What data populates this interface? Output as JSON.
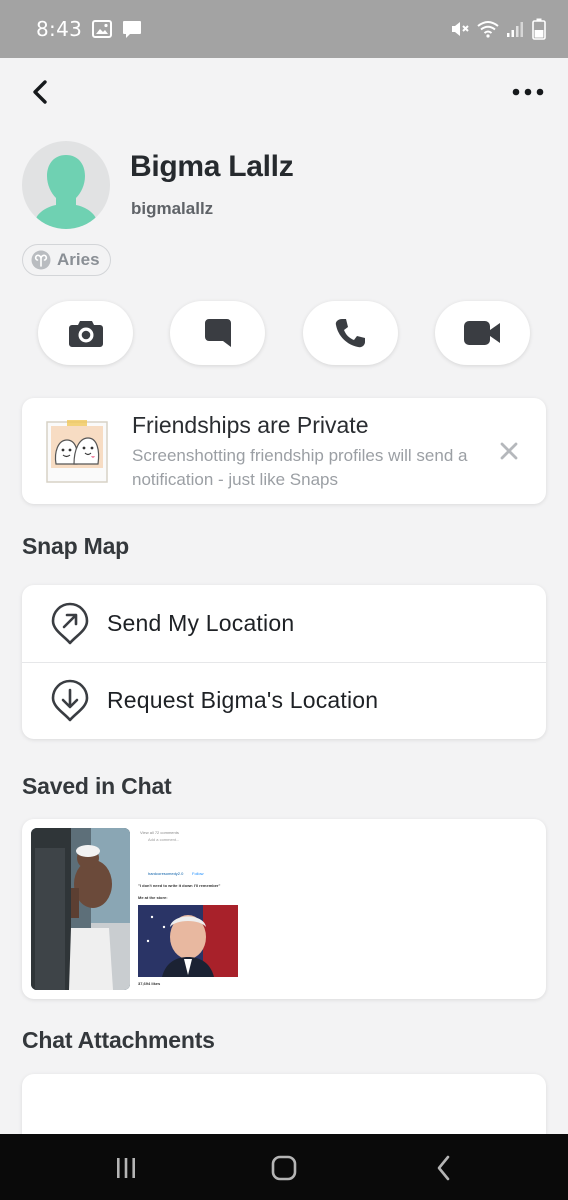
{
  "status_bar": {
    "time": "8:43",
    "icons": [
      "gallery-icon",
      "message-icon",
      "mute-icon",
      "wifi-icon",
      "signal-icon",
      "battery-icon"
    ]
  },
  "nav": {
    "back_icon": "chevron-left-icon",
    "more_icon": "more-horizontal-icon"
  },
  "profile": {
    "display_name": "Bigma Lallz",
    "username": "bigmalallz",
    "zodiac": "Aries",
    "avatar_color": "#6fd1b2"
  },
  "actions": [
    {
      "name": "camera",
      "icon": "camera-icon"
    },
    {
      "name": "chat",
      "icon": "chat-bubble-icon"
    },
    {
      "name": "call",
      "icon": "phone-icon"
    },
    {
      "name": "video",
      "icon": "video-camera-icon"
    }
  ],
  "friendship_card": {
    "title": "Friendships are Private",
    "subtitle": "Screenshotting friendship profiles will send a notification - just like Snaps"
  },
  "snap_map": {
    "title": "Snap Map",
    "items": [
      {
        "label": "Send My Location",
        "icon": "location-arrow-icon"
      },
      {
        "label": "Request Bigma's Location",
        "icon": "location-request-icon"
      }
    ]
  },
  "saved_in_chat": {
    "title": "Saved in Chat",
    "post": {
      "view_comments": "View all 72 comments",
      "add_comment": "Add a comment...",
      "comment_handle": "hardcoresomedy2.0",
      "follow": "Follow",
      "quote": "\"I don't need to write it down I'll remember\"",
      "caption": "Me at the store:",
      "likes": "37,694 likes"
    }
  },
  "chat_attachments": {
    "title": "Chat Attachments"
  },
  "colors": {
    "background": "#f3f3f4",
    "card": "#ffffff",
    "icon_dark": "#3a3d42",
    "muted_text": "#9b9fa4"
  }
}
